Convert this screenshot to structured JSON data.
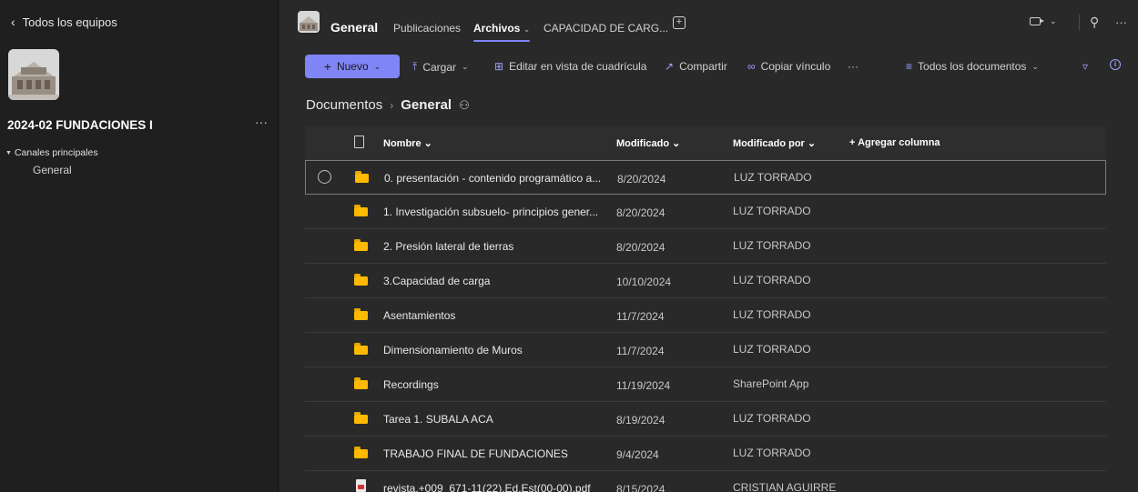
{
  "sidebar": {
    "back_label": "Todos los equipos",
    "team_name": "2024-02 FUNDACIONES I",
    "more": "···",
    "channels_header": "Canales principales",
    "channel": "General"
  },
  "header": {
    "channel_name": "General",
    "tabs": [
      {
        "label": "Publicaciones"
      },
      {
        "label": "Archivos"
      },
      {
        "label": "CAPACIDAD DE CARG..."
      }
    ],
    "more": "···"
  },
  "toolbar": {
    "new_label": "Nuevo",
    "upload_label": "Cargar",
    "grid_label": "Editar en vista de cuadrícula",
    "share_label": "Compartir",
    "copy_link_label": "Copiar vínculo",
    "more": "···",
    "view_label": "Todos los documentos"
  },
  "breadcrumb": {
    "root": "Documentos",
    "current": "General"
  },
  "table": {
    "headers": {
      "name": "Nombre",
      "modified": "Modificado",
      "modified_by": "Modificado por",
      "add_column": "+ Agregar columna"
    },
    "rows": [
      {
        "type": "folder",
        "name": "0. presentación - contenido programático a...",
        "modified": "8/20/2024",
        "by": "LUZ TORRADO"
      },
      {
        "type": "folder",
        "name": "1. Investigación subsuelo- principios gener...",
        "modified": "8/20/2024",
        "by": "LUZ TORRADO"
      },
      {
        "type": "folder",
        "name": "2. Presión lateral de tierras",
        "modified": "8/20/2024",
        "by": "LUZ TORRADO"
      },
      {
        "type": "folder",
        "name": "3.Capacidad de carga",
        "modified": "10/10/2024",
        "by": "LUZ TORRADO"
      },
      {
        "type": "folder",
        "name": "Asentamientos",
        "modified": "11/7/2024",
        "by": "LUZ TORRADO"
      },
      {
        "type": "folder",
        "name": "Dimensionamiento de Muros",
        "modified": "11/7/2024",
        "by": "LUZ TORRADO"
      },
      {
        "type": "folder",
        "name": "Recordings",
        "modified": "11/19/2024",
        "by": "SharePoint App"
      },
      {
        "type": "folder",
        "name": "Tarea 1. SUBALA ACA",
        "modified": "8/19/2024",
        "by": "LUZ TORRADO"
      },
      {
        "type": "folder",
        "name": "TRABAJO FINAL DE FUNDACIONES",
        "modified": "9/4/2024",
        "by": "LUZ TORRADO"
      },
      {
        "type": "pdf",
        "name": "revista,+009_671-11(22).Ed.Est(00-00).pdf",
        "modified": "8/15/2024",
        "by": "CRISTIAN AGUIRRE"
      }
    ]
  },
  "colors": {
    "accent": "#7f85f5",
    "folder": "#ffb900",
    "background": "#292929",
    "sidebar": "#1f1f1f"
  }
}
